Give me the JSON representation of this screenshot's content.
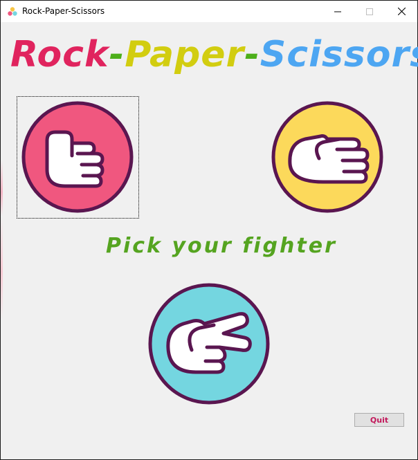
{
  "window": {
    "title": "Rock-Paper-Scissors",
    "controls": {
      "minimize": "minimize",
      "maximize": "maximize",
      "close": "close"
    }
  },
  "headline": {
    "parts": [
      "Rock",
      "-",
      "Paper",
      "-",
      "Scissors"
    ],
    "colors": [
      "#e0245e",
      "#4caf1a",
      "#d2cd10",
      "#4caf1a",
      "#4da6f2"
    ]
  },
  "fighters": {
    "rock": {
      "icon": "rock-fist-icon",
      "color": "#f0577f"
    },
    "paper": {
      "icon": "paper-hand-icon",
      "color": "#fcd95b"
    },
    "scissors": {
      "icon": "scissors-hand-icon",
      "color": "#74d6e0"
    }
  },
  "prompt": "Pick your fighter",
  "quit_label": "Quit",
  "colors": {
    "ring": "#5a1650",
    "prompt": "#55a420",
    "quit_text": "#c2185b"
  }
}
